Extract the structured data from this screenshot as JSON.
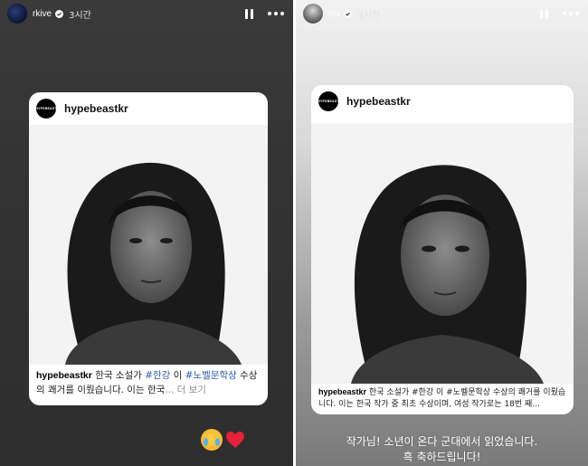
{
  "left_story": {
    "username": "rkive",
    "time": "3시간",
    "post": {
      "brand": "hypebeastkr",
      "logo_text": "HYPEBEAST",
      "caption_user": "hypebeastkr",
      "caption_text_1": " 한국 소설가 ",
      "tag_1": "#한강",
      "caption_text_2": " 이 ",
      "tag_2": "#노벨문학상",
      "caption_text_3": " 수상의 쾌거를 이뤘습니다. 이는 한국",
      "more_label": "... 더 보기"
    },
    "reactions": [
      "crying-face",
      "red-heart"
    ]
  },
  "right_story": {
    "username": "thv",
    "time": "3시간",
    "post": {
      "brand": "hypebeastkr",
      "logo_text": "HYPEBEAST",
      "caption_user": "hypebeastkr",
      "caption_text": " 한국 소설가 #한강 이 #노벨문학상 수상의 쾌거를 이뤘습니다. 이는 한국 작가 중 최초 수상이며, 여성 작가로는 18번 째..."
    },
    "story_text_line1": "작가님! 소년이 온다 군대에서 읽었습니다.",
    "story_text_line2": "흑 축하드립니다!"
  },
  "colors": {
    "left_bg": "#333333",
    "right_bg_top": "#f2f2f2",
    "right_bg_bottom": "#7a7a7a",
    "tag_blue": "#2a5db0"
  }
}
